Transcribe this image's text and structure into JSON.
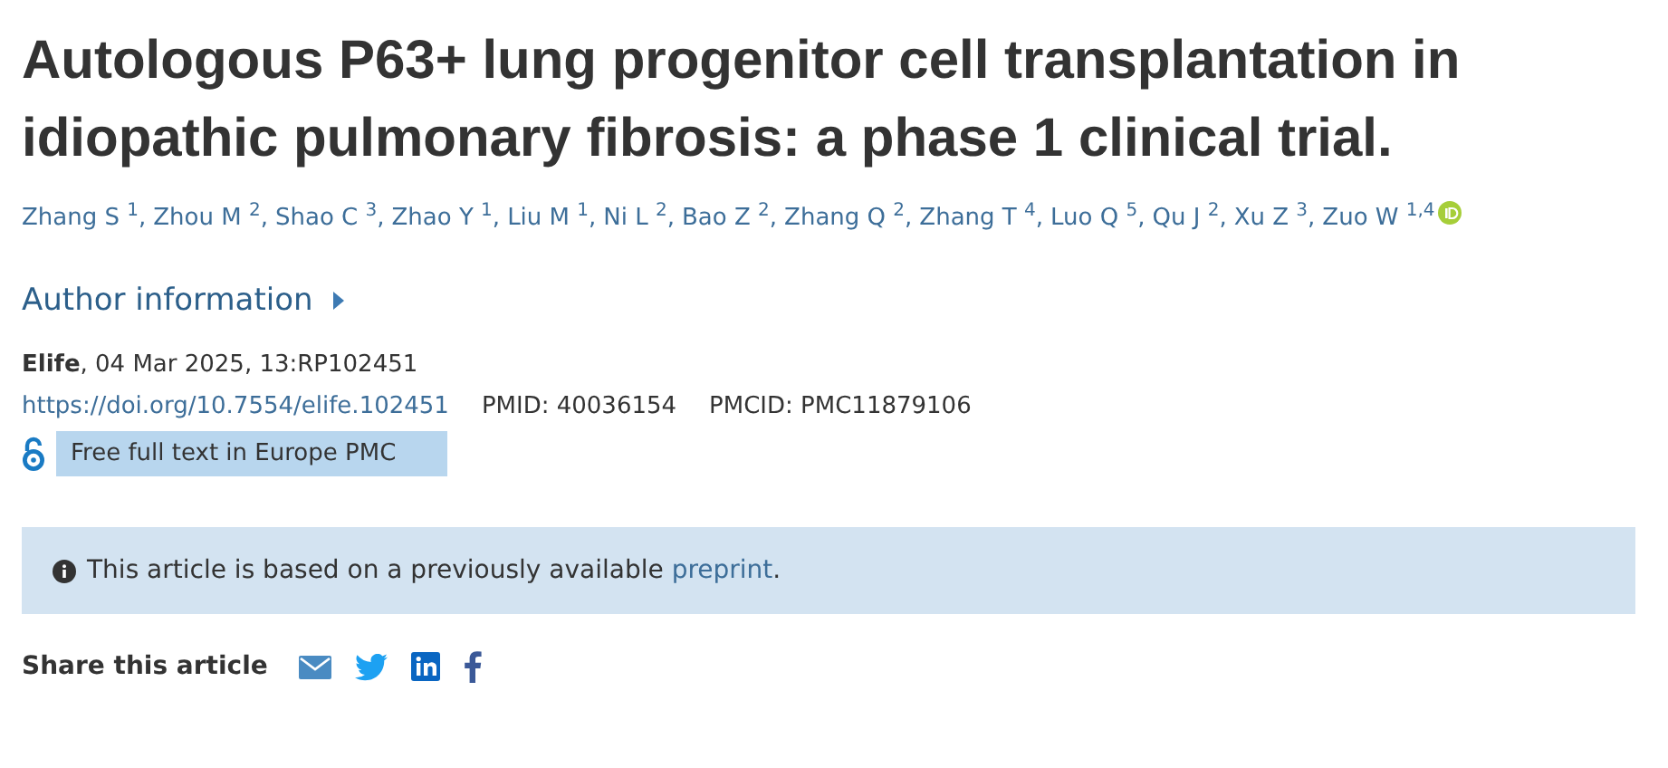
{
  "title": "Autologous P63+ lung progenitor cell transplantation in idiopathic pulmonary fibrosis: a phase 1 clinical trial.",
  "authors": [
    {
      "name": "Zhang S $^{1}$,",
      "orcid": false
    },
    {
      "name": "Zhou M $^{2}$,",
      "orcid": false
    },
    {
      "name": "Shao C $^{3}$,",
      "orcid": false
    },
    {
      "name": "Zhao Y $^{1}$,",
      "orcid": false
    },
    {
      "name": "Liu M $^{1}$,",
      "orcid": false
    },
    {
      "name": "Ni L $^{2}$,",
      "orcid": false
    },
    {
      "name": "Bao Z $^{2}$,",
      "orcid": false
    },
    {
      "name": "Zhang Q $^{2}$,",
      "orcid": false
    },
    {
      "name": "Zhang T $^{4}$,",
      "orcid": false
    },
    {
      "name": "Luo Q $^{5}$,",
      "orcid": false
    },
    {
      "name": "Qu J $^{2}$,",
      "orcid": false
    },
    {
      "name": "Xu Z $^{3}$,",
      "orcid": false
    },
    {
      "name": "Zuo W $^{1,4}$",
      "orcid": true
    }
  ],
  "author_information": {
    "label": "Author information",
    "expanded": false
  },
  "journal_line": "**Elife**, 04 Mar 2025, 13:RP102451",
  "doi": "https://doi.org/10.7554/elife.102451",
  "pmid": "PMID: 40036154",
  "pmcid": "PMCID: PMC11879106",
  "free_full_text": "Free full text in Europe PMC",
  "notice": {
    "before": "This article is based on a previously available",
    "link": "preprint",
    "after": "."
  },
  "share": {
    "label": "Share this article",
    "icons": [
      {
        "kind": "email"
      },
      {
        "kind": "twitter"
      },
      {
        "kind": "linkedin"
      },
      {
        "kind": "facebook"
      }
    ]
  }
}
